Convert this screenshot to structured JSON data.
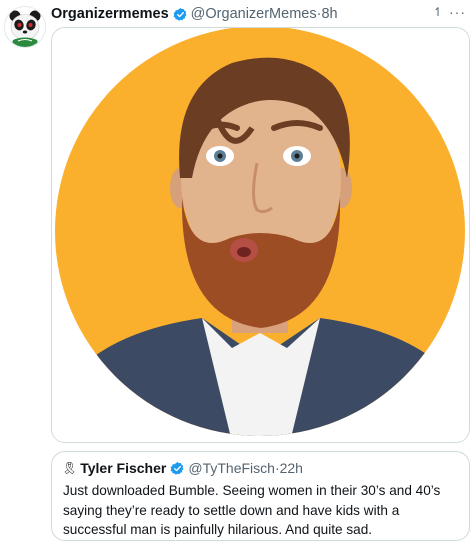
{
  "tweet": {
    "display_name": "Organizermemes",
    "handle": "@OrganizerMemes",
    "separator": "·",
    "time": "8h",
    "avatar_icon": "panda-avatar-icon",
    "verified_icon": "verified-badge-icon",
    "accent_color": "#1d9bf0"
  },
  "media": {
    "background_color": "#ffb733",
    "circle_color": "#fbb02d"
  },
  "quoted_tweet": {
    "emoji": "🎗",
    "display_name": "Tyler Fischer",
    "handle": "@TyTheFisch",
    "separator": "·",
    "time": "22h",
    "text": "Just downloaded Bumble. Seeing women in their 30’s and 40’s saying they’re ready to settle down and have kids with a successful man is painfully hilarious. And quite sad."
  }
}
